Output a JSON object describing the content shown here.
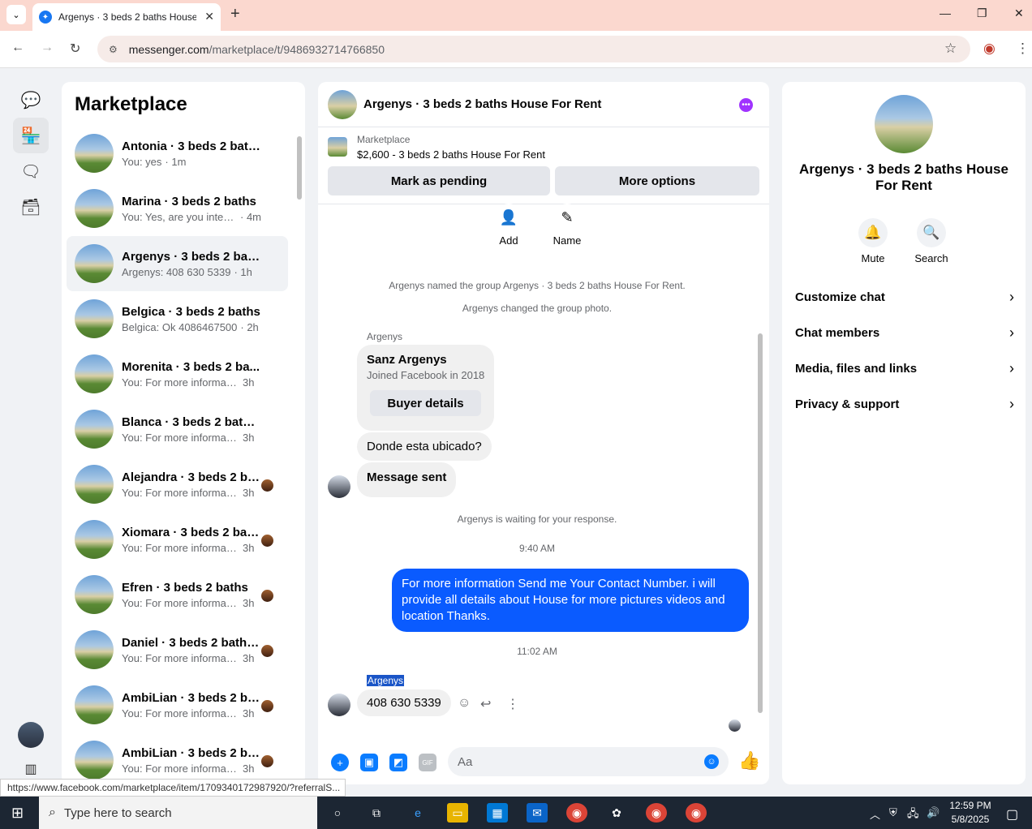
{
  "browser": {
    "tab_title": "Argenys · 3 beds 2 baths House For Rent",
    "url_domain": "messenger.com",
    "url_path": "/marketplace/t/9486932714766850",
    "status_url": "https://www.facebook.com/marketplace/item/1709340172987920/?referralS..."
  },
  "sidebar": {
    "title": "Marketplace",
    "conversations": [
      {
        "name": "Antonia · 3 beds 2 baths",
        "preview": "You: yes",
        "time": "· 1m"
      },
      {
        "name": "Marina · 3 beds 2 baths",
        "preview": "You: Yes, are you intere...",
        "time": "· 4m"
      },
      {
        "name": "Argenys · 3 beds 2 bat...",
        "preview": "Argenys: 408 630 5339",
        "time": "· 1h"
      },
      {
        "name": "Belgica · 3 beds 2 baths",
        "preview": "Belgica: Ok 4086467500",
        "time": "· 2h"
      },
      {
        "name": "Morenita · 3 beds 2 ba...",
        "preview": "You: For more informati...",
        "time": "3h"
      },
      {
        "name": "Blanca · 3 beds 2 baths...",
        "preview": "You: For more informati...",
        "time": "3h"
      },
      {
        "name": "Alejandra · 3 beds 2 ba...",
        "preview": "You: For more informati...",
        "time": "3h"
      },
      {
        "name": "Xiomara · 3 beds 2 baths",
        "preview": "You: For more informati...",
        "time": "3h"
      },
      {
        "name": "Efren · 3 beds 2 baths",
        "preview": "You: For more informati...",
        "time": "3h"
      },
      {
        "name": "Daniel · 3 beds 2 baths...",
        "preview": "You: For more informati...",
        "time": "3h"
      },
      {
        "name": "AmbiLian · 3 beds 2 ba...",
        "preview": "You: For more informati...",
        "time": "3h"
      },
      {
        "name": "AmbiLian · 3 beds 2 ba...",
        "preview": "You: For more informati...",
        "time": "3h"
      }
    ]
  },
  "chat": {
    "title": "Argenys · 3 beds 2 baths House For Rent",
    "listing_label": "Marketplace",
    "listing_desc": "$2,600 - 3 beds 2 baths House For Rent",
    "mark_pending": "Mark as pending",
    "more_options": "More options",
    "add_label": "Add",
    "name_label": "Name",
    "sys1": "Argenys named the group Argenys · 3 beds 2 baths House For Rent.",
    "sys2": "Argenys changed the group photo.",
    "sender1": "Argenys",
    "card_name": "Sanz Argenys",
    "card_sub": "Joined Facebook in 2018",
    "buyer_details": "Buyer details",
    "msg_where": "Donde esta ubicado?",
    "msg_sent": "Message sent",
    "waiting": "Argenys is waiting for your response.",
    "time1": "9:40 AM",
    "my_msg": "For more information  Send me Your Contact Number.  i will provide all details about House for more pictures videos and location Thanks.",
    "time2": "11:02 AM",
    "sender2": "Argenys",
    "phone_msg": "408 630 5339",
    "input_placeholder": "Aa"
  },
  "info": {
    "title": "Argenys · 3 beds 2 baths House For Rent",
    "mute": "Mute",
    "search": "Search",
    "rows": [
      "Customize chat",
      "Chat members",
      "Media, files and links",
      "Privacy & support"
    ]
  },
  "taskbar": {
    "search_placeholder": "Type here to search",
    "time": "12:59 PM",
    "date": "5/8/2025"
  }
}
